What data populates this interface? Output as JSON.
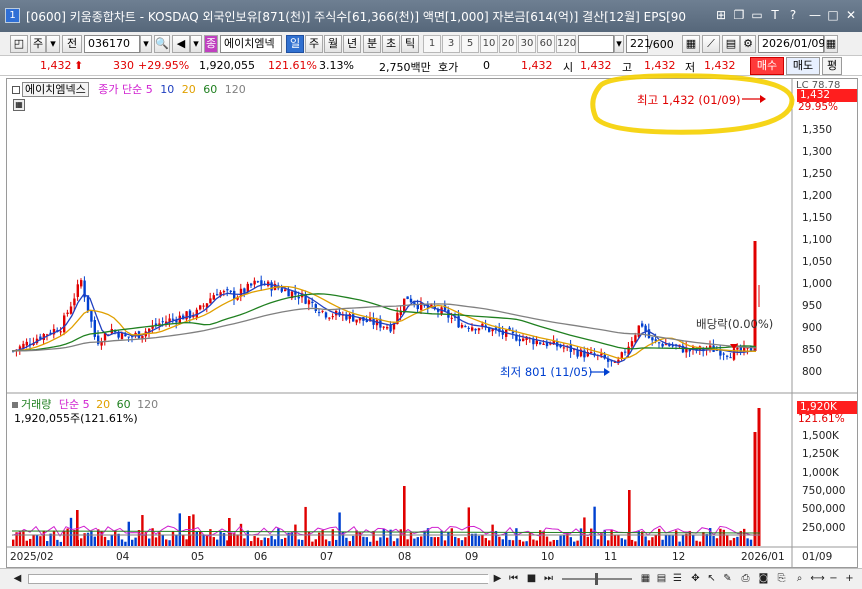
{
  "window": {
    "number": "1",
    "title": "[0600] 키움종합차트 - KOSDAQ 외국인보유[871(천)] 주식수[61,366(천)] 액면[1,000] 자본금[614(억)] 결산[12월] EPS[90",
    "controls": [
      "?",
      "□",
      "□",
      "T",
      "?",
      "—",
      "□",
      "X"
    ]
  },
  "toolbar": {
    "buttons_left": [
      "주",
      "전"
    ],
    "code": "036170",
    "stock_name": "에이치엠넥",
    "periods": [
      "일",
      "주",
      "월",
      "년",
      "분",
      "초",
      "틱"
    ],
    "active_period": "일",
    "numbers": [
      "1",
      "3",
      "5",
      "10",
      "20",
      "30",
      "60",
      "120"
    ],
    "count": "221",
    "count_max": "/600",
    "date": "2026/01/09"
  },
  "quote": {
    "price": "1,432",
    "change": "330",
    "change_pct": "+29.95%",
    "volume": "1,920,055",
    "volume_ratio": "121.61%",
    "turnover": "3.13%",
    "amount": "2,750백만",
    "hoga_label": "호가",
    "hoga_value": "0",
    "hoga_price": "1,432",
    "open_label": "시",
    "open": "1,432",
    "high_label": "고",
    "high": "1,432",
    "low_label": "저",
    "low": "1,432",
    "buy": "매수",
    "sell": "매도",
    "avg": "평"
  },
  "price_chart": {
    "stock_label": "에이치엠넥스",
    "ma_label": "종가 단순",
    "ma_periods": [
      "5",
      "10",
      "20",
      "60",
      "120"
    ],
    "ma_colors": [
      "#d020d0",
      "#2040c0",
      "#e0a000",
      "#208020",
      "#808080"
    ],
    "high_annotation": "최고 1,432 (01/09)",
    "low_annotation": "최저 801 (11/05)",
    "dividend_annotation": "배당락(0.00%)",
    "price_box": "1,432",
    "change_box": "29.95%",
    "top_label": "LC 78.78",
    "y_ticks": [
      "1,350",
      "1,300",
      "1,250",
      "1,200",
      "1,150",
      "1,100",
      "1,050",
      "1,000",
      "950",
      "900",
      "850",
      "800"
    ]
  },
  "volume_chart": {
    "label": "거래량",
    "ma_label": "단순",
    "ma_periods": [
      "5",
      "20",
      "60",
      "120"
    ],
    "ma_colors": [
      "#d020d0",
      "#e0a000",
      "#208020",
      "#808080"
    ],
    "current": "1,920,055주(121.61%)",
    "box_value": "1,920K",
    "box_pct": "121.61%",
    "y_ticks": [
      "1,500K",
      "1,250K",
      "1,000K",
      "750,000",
      "500,000",
      "250,000"
    ]
  },
  "x_axis": {
    "labels": [
      "2025/02",
      "04",
      "05",
      "06",
      "07",
      "08",
      "09",
      "10",
      "11",
      "12",
      "2026/01",
      "01/09"
    ]
  },
  "colors": {
    "up": "#e00000",
    "down": "#0040d0",
    "highlight": "#f5d000"
  }
}
